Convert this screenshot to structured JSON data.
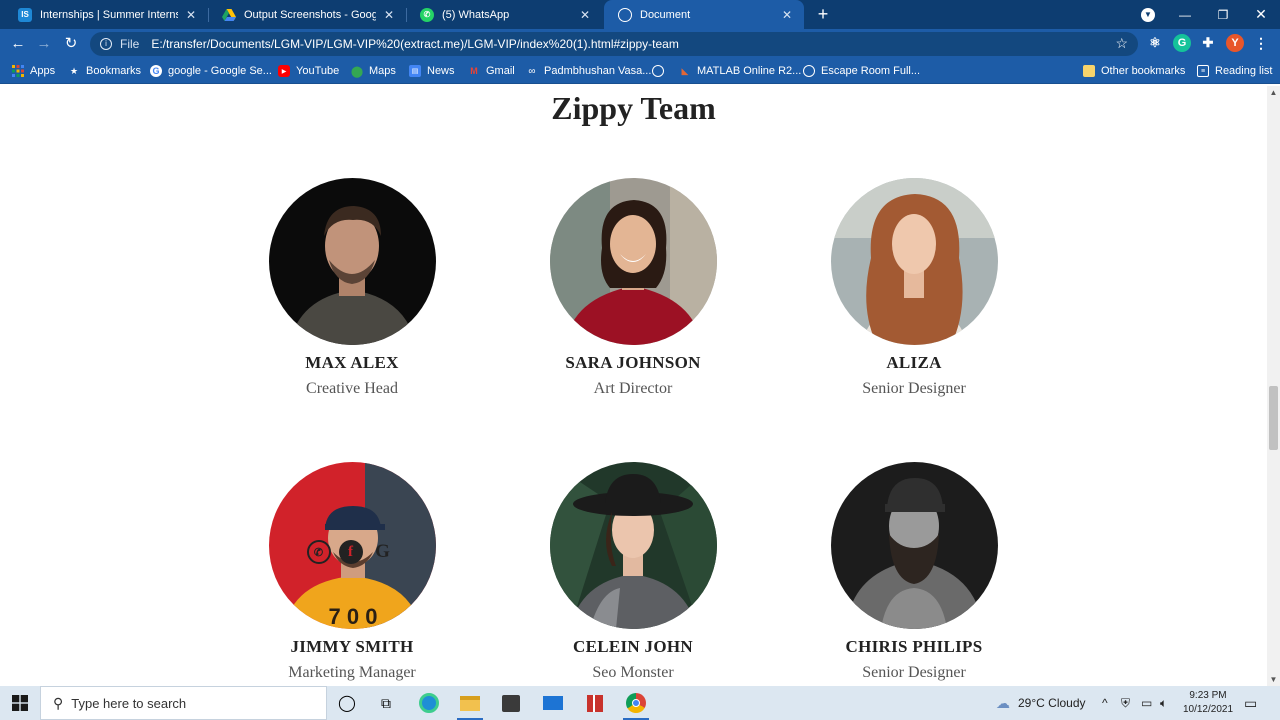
{
  "browser": {
    "tabs": [
      {
        "title": "Internships | Summer Internship",
        "favicon": "IS",
        "active": false
      },
      {
        "title": "Output Screenshots - Google Dri",
        "favicon": "drive",
        "active": false
      },
      {
        "title": "(5) WhatsApp",
        "favicon": "whatsapp",
        "active": false
      },
      {
        "title": "Document",
        "favicon": "globe",
        "active": true
      }
    ],
    "address": {
      "scheme_label": "File",
      "url": "E:/transfer/Documents/LGM-VIP/LGM-VIP%20(extract.me)/LGM-VIP/index%20(1).html#zippy-team"
    },
    "profile_initial": "Y",
    "bookmarks": [
      {
        "label": "Apps",
        "icon": "apps-grid-icon"
      },
      {
        "label": "Bookmarks",
        "icon": "star-icon"
      },
      {
        "label": "google - Google Se...",
        "icon": "google-icon"
      },
      {
        "label": "YouTube",
        "icon": "youtube-icon"
      },
      {
        "label": "Maps",
        "icon": "maps-icon"
      },
      {
        "label": "News",
        "icon": "news-icon"
      },
      {
        "label": "Gmail",
        "icon": "gmail-icon"
      },
      {
        "label": "Padmbhushan Vasa...",
        "icon": "link-icon"
      },
      {
        "label": "",
        "icon": "globe-icon"
      },
      {
        "label": "MATLAB Online R2...",
        "icon": "matlab-icon"
      },
      {
        "label": "Escape Room Full...",
        "icon": "globe-icon"
      },
      {
        "label": "Other bookmarks",
        "icon": "folder-icon"
      },
      {
        "label": "Reading list",
        "icon": "reading-list-icon"
      }
    ]
  },
  "page": {
    "heading": "Zippy Team",
    "members": [
      {
        "name": "MAX ALEX",
        "role": "Creative Head"
      },
      {
        "name": "SARA JOHNSON",
        "role": "Art Director"
      },
      {
        "name": "ALIZA",
        "role": "Senior Designer"
      },
      {
        "name": "JIMMY SMITH",
        "role": "Marketing Manager"
      },
      {
        "name": "CELEIN JOHN",
        "role": "Seo Monster"
      },
      {
        "name": "CHIRIS PHILIPS",
        "role": "Senior Designer"
      }
    ]
  },
  "taskbar": {
    "search_placeholder": "Type here to search",
    "weather": "29°C  Cloudy",
    "time": "9:23 PM",
    "date": "10/12/2021"
  }
}
